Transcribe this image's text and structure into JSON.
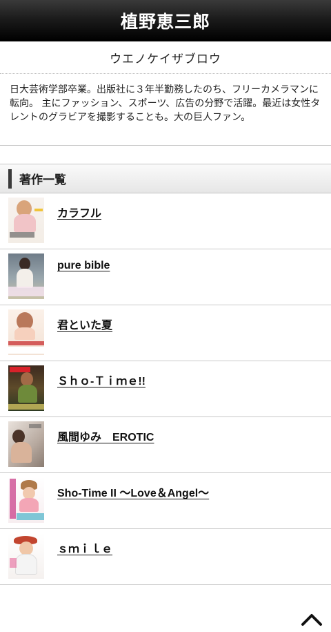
{
  "header": {
    "title": "植野恵三郎"
  },
  "profile": {
    "reading": "ウエノケイザブロウ",
    "bio": "日大芸術学部卒業。出版社に３年半勤務したのち、フリーカメラマンに転向。 主にファッション、スポーツ、広告の分野で活躍。最近は女性タレントのグラビアを撮影することも。大の巨人ファン。"
  },
  "works": {
    "heading": "著作一覧",
    "items": [
      {
        "title": "カラフル"
      },
      {
        "title": "pure bible"
      },
      {
        "title": "君といた夏"
      },
      {
        "title": "Ｓｈｏ-Ｔｉｍｅ!!"
      },
      {
        "title": "風間ゆみ　EROTIC"
      },
      {
        "title": "Sho-Time II 〜Love＆Angel〜"
      },
      {
        "title": "ｓｍｉｌｅ"
      }
    ]
  },
  "colors": {
    "header_bg": "#000000",
    "header_text": "#ffffff",
    "section_bar": "#3a3a3a"
  },
  "icons": {
    "back_to_top": "chevron-up-icon"
  }
}
